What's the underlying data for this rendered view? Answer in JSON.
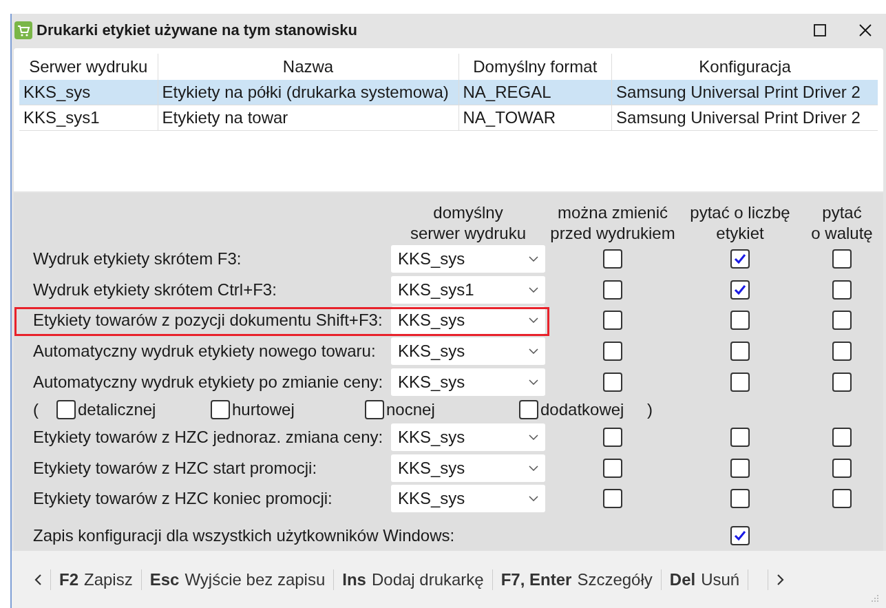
{
  "window": {
    "title": "Drukarki etykiet używane na tym stanowisku"
  },
  "table": {
    "columns": [
      "Serwer wydruku",
      "Nazwa",
      "Domyślny format",
      "Konfiguracja"
    ],
    "rows": [
      {
        "selected": true,
        "cells": [
          "KKS_sys",
          "Etykiety na półki (drukarka systemowa)",
          "NA_REGAL",
          "Samsung Universal Print Driver 2"
        ]
      },
      {
        "selected": false,
        "cells": [
          "KKS_sys1",
          "Etykiety na towar",
          "NA_TOWAR",
          "Samsung Universal Print Driver 2"
        ]
      }
    ]
  },
  "settings": {
    "headers": [
      "domyślny\nserwer wydruku",
      "można zmienić\nprzed wydrukiem",
      "pytać o liczbę\netykiet",
      "pytać\no walutę"
    ],
    "rows": [
      {
        "kind": "setting",
        "label": "Wydruk etykiety skrótem F3:",
        "server": "KKS_sys",
        "highlighted": false,
        "checks": [
          false,
          true,
          false
        ]
      },
      {
        "kind": "setting",
        "label": "Wydruk etykiety skrótem Ctrl+F3:",
        "server": "KKS_sys1",
        "highlighted": false,
        "checks": [
          false,
          true,
          false
        ]
      },
      {
        "kind": "setting",
        "label": "Etykiety towarów z pozycji dokumentu Shift+F3:",
        "server": "KKS_sys",
        "highlighted": true,
        "checks": [
          false,
          false,
          false
        ]
      },
      {
        "kind": "setting",
        "label": "Automatyczny wydruk etykiety nowego towaru:",
        "server": "KKS_sys",
        "highlighted": false,
        "checks": [
          false,
          false,
          false
        ]
      },
      {
        "kind": "setting",
        "label": "Automatyczny wydruk etykiety po zmianie ceny:",
        "server": "KKS_sys",
        "highlighted": false,
        "checks": [
          false,
          false,
          false
        ]
      },
      {
        "kind": "options",
        "open": "(",
        "close": ")",
        "options": [
          {
            "label": "detalicznej",
            "checked": false
          },
          {
            "label": "hurtowej",
            "checked": false
          },
          {
            "label": "nocnej",
            "checked": false
          },
          {
            "label": "dodatkowej",
            "checked": false
          }
        ]
      },
      {
        "kind": "setting",
        "label": "Etykiety towarów z HZC jednoraz. zmiana ceny:",
        "server": "KKS_sys",
        "highlighted": false,
        "checks": [
          false,
          false,
          false
        ]
      },
      {
        "kind": "setting",
        "label": "Etykiety towarów z HZC start promocji:",
        "server": "KKS_sys",
        "highlighted": false,
        "checks": [
          false,
          false,
          false
        ]
      },
      {
        "kind": "setting",
        "label": "Etykiety towarów z HZC koniec promocji:",
        "server": "KKS_sys",
        "highlighted": false,
        "checks": [
          false,
          false,
          false
        ]
      },
      {
        "kind": "global",
        "label": "Zapis konfiguracji dla wszystkich użytkowników Windows:",
        "checked": true
      }
    ]
  },
  "footer": [
    {
      "key": "F2",
      "label": "Zapisz"
    },
    {
      "key": "Esc",
      "label": "Wyjście bez zapisu"
    },
    {
      "key": "Ins",
      "label": "Dodaj drukarkę"
    },
    {
      "key": "F7, Enter",
      "label": "Szczegóły"
    },
    {
      "key": "Del",
      "label": "Usuń"
    }
  ]
}
